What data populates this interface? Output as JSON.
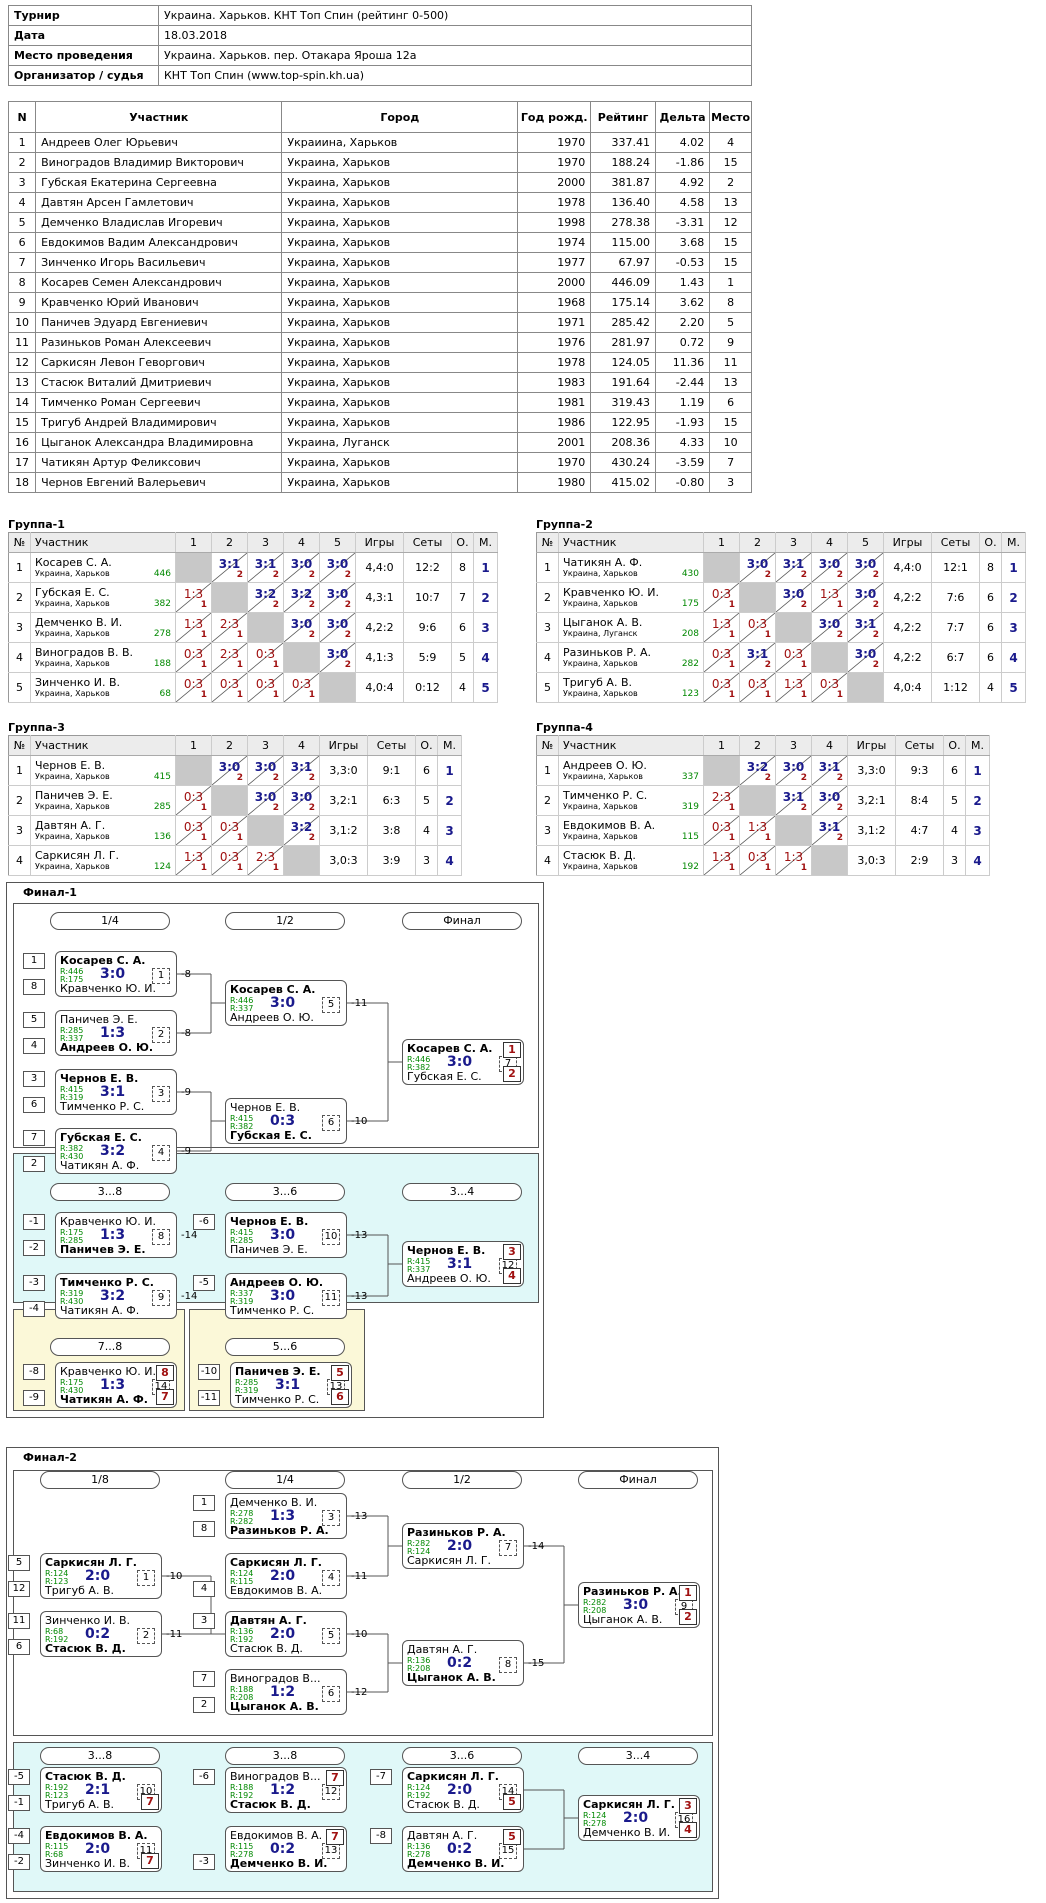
{
  "info": [
    {
      "k": "Турнир",
      "v": "Украина. Харьков. КНТ Топ Спин (рейтинг 0-500)"
    },
    {
      "k": "Дата",
      "v": "18.03.2018"
    },
    {
      "k": "Место проведения",
      "v": "Украина. Харьков. пер. Отакара Яроша 12а"
    },
    {
      "k": "Организатор / судья",
      "v": "КНТ Топ Спин (www.top-spin.kh.ua)"
    }
  ],
  "players_header": [
    "N",
    "Участник",
    "Город",
    "Год рожд.",
    "Рейтинг",
    "Дельта",
    "Место"
  ],
  "players": [
    [
      "1",
      "Андреев Олег Юрьевич",
      "Украиина, Харьков",
      "1970",
      "337.41",
      "4.02",
      "4"
    ],
    [
      "2",
      "Виноградов Владимир Викторович",
      "Украина, Харьков",
      "1970",
      "188.24",
      "-1.86",
      "15"
    ],
    [
      "3",
      "Губская Екатерина Сергеевна",
      "Украина, Харьков",
      "2000",
      "381.87",
      "4.92",
      "2"
    ],
    [
      "4",
      "Давтян Арсен Гамлетович",
      "Украина, Харьков",
      "1978",
      "136.40",
      "4.58",
      "13"
    ],
    [
      "5",
      "Демченко Владислав Игоревич",
      "Украина, Харьков",
      "1998",
      "278.38",
      "-3.31",
      "12"
    ],
    [
      "6",
      "Евдокимов Вадим Александрович",
      "Украина, Харьков",
      "1974",
      "115.00",
      "3.68",
      "15"
    ],
    [
      "7",
      "Зинченко Игорь Васильевич",
      "Украина, Харьков",
      "1977",
      "67.97",
      "-0.53",
      "15"
    ],
    [
      "8",
      "Косарев Семен Александрович",
      "Украина, Харьков",
      "2000",
      "446.09",
      "1.43",
      "1"
    ],
    [
      "9",
      "Кравченко Юрий Иванович",
      "Украина, Харьков",
      "1968",
      "175.14",
      "3.62",
      "8"
    ],
    [
      "10",
      "Паничев Эдуард Евгениевич",
      "Украина, Харьков",
      "1971",
      "285.42",
      "2.20",
      "5"
    ],
    [
      "11",
      "Разиньков Роман Алексеевич",
      "Украина, Харьков",
      "1976",
      "281.97",
      "0.72",
      "9"
    ],
    [
      "12",
      "Саркисян Левон Геворгович",
      "Украина, Харьков",
      "1978",
      "124.05",
      "11.36",
      "11"
    ],
    [
      "13",
      "Стасюк Виталий Дмитриевич",
      "Украина, Харьков",
      "1983",
      "191.64",
      "-2.44",
      "13"
    ],
    [
      "14",
      "Тимченко Роман Сергеевич",
      "Украина, Харьков",
      "1981",
      "319.43",
      "1.19",
      "6"
    ],
    [
      "15",
      "Тригуб Андрей Владимирович",
      "Украина, Харьков",
      "1986",
      "122.95",
      "-1.93",
      "15"
    ],
    [
      "16",
      "Цыганок Александра Владимировна",
      "Украина, Луганск",
      "2001",
      "208.36",
      "4.33",
      "10"
    ],
    [
      "17",
      "Чатикян Артур Феликсович",
      "Украина, Харьков",
      "1970",
      "430.24",
      "-3.59",
      "7"
    ],
    [
      "18",
      "Чернов Евгений Валерьевич",
      "Украина, Харьков",
      "1980",
      "415.02",
      "-0.80",
      "3"
    ]
  ],
  "groups": [
    {
      "title": "Группа-1",
      "rows": [
        {
          "n": "1",
          "name": "Косарев С. А.",
          "city": "Украина, Харьков",
          "r": "446",
          "cells": [
            "X",
            "3:1|2",
            "3:1|2",
            "3:0|2",
            "3:0|2"
          ],
          "games": "4,4:0",
          "sets": "12:2",
          "o": "8",
          "m": "1"
        },
        {
          "n": "2",
          "name": "Губская Е. С.",
          "city": "Украина, Харьков",
          "r": "382",
          "cells": [
            "1:3|1",
            "X",
            "3:2|2",
            "3:2|2",
            "3:0|2"
          ],
          "games": "4,3:1",
          "sets": "10:7",
          "o": "7",
          "m": "2"
        },
        {
          "n": "3",
          "name": "Демченко В. И.",
          "city": "Украина, Харьков",
          "r": "278",
          "cells": [
            "1:3|1",
            "2:3|1",
            "X",
            "3:0|2",
            "3:0|2"
          ],
          "games": "4,2:2",
          "sets": "9:6",
          "o": "6",
          "m": "3"
        },
        {
          "n": "4",
          "name": "Виноградов В. В.",
          "city": "Украина, Харьков",
          "r": "188",
          "cells": [
            "0:3|1",
            "2:3|1",
            "0:3|1",
            "X",
            "3:0|2"
          ],
          "games": "4,1:3",
          "sets": "5:9",
          "o": "5",
          "m": "4"
        },
        {
          "n": "5",
          "name": "Зинченко И. В.",
          "city": "Украина, Харьков",
          "r": "68",
          "cells": [
            "0:3|1",
            "0:3|1",
            "0:3|1",
            "0:3|1",
            "X"
          ],
          "games": "4,0:4",
          "sets": "0:12",
          "o": "4",
          "m": "5"
        }
      ]
    },
    {
      "title": "Группа-2",
      "rows": [
        {
          "n": "1",
          "name": "Чатикян А. Ф.",
          "city": "Украина, Харьков",
          "r": "430",
          "cells": [
            "X",
            "3:0|2",
            "3:1|2",
            "3:0|2",
            "3:0|2"
          ],
          "games": "4,4:0",
          "sets": "12:1",
          "o": "8",
          "m": "1"
        },
        {
          "n": "2",
          "name": "Кравченко Ю. И.",
          "city": "Украина, Харьков",
          "r": "175",
          "cells": [
            "0:3|1",
            "X",
            "3:0|2",
            "1:3|1",
            "3:0|2"
          ],
          "games": "4,2:2",
          "sets": "7:6",
          "o": "6",
          "m": "2"
        },
        {
          "n": "3",
          "name": "Цыганок А. В.",
          "city": "Украина, Луганск",
          "r": "208",
          "cells": [
            "1:3|1",
            "0:3|1",
            "X",
            "3:0|2",
            "3:1|2"
          ],
          "games": "4,2:2",
          "sets": "7:7",
          "o": "6",
          "m": "3"
        },
        {
          "n": "4",
          "name": "Разиньков Р. А.",
          "city": "Украина, Харьков",
          "r": "282",
          "cells": [
            "0:3|1",
            "3:1|2",
            "0:3|1",
            "X",
            "3:0|2"
          ],
          "games": "4,2:2",
          "sets": "6:7",
          "o": "6",
          "m": "4"
        },
        {
          "n": "5",
          "name": "Тригуб А. В.",
          "city": "Украина, Харьков",
          "r": "123",
          "cells": [
            "0:3|1",
            "0:3|1",
            "1:3|1",
            "0:3|1",
            "X"
          ],
          "games": "4,0:4",
          "sets": "1:12",
          "o": "4",
          "m": "5"
        }
      ]
    },
    {
      "title": "Группа-3",
      "rows": [
        {
          "n": "1",
          "name": "Чернов Е. В.",
          "city": "Украина, Харьков",
          "r": "415",
          "cells": [
            "X",
            "3:0|2",
            "3:0|2",
            "3:1|2"
          ],
          "games": "3,3:0",
          "sets": "9:1",
          "o": "6",
          "m": "1"
        },
        {
          "n": "2",
          "name": "Паничев Э. Е.",
          "city": "Украина, Харьков",
          "r": "285",
          "cells": [
            "0:3|1",
            "X",
            "3:0|2",
            "3:0|2"
          ],
          "games": "3,2:1",
          "sets": "6:3",
          "o": "5",
          "m": "2"
        },
        {
          "n": "3",
          "name": "Давтян А. Г.",
          "city": "Украина, Харьков",
          "r": "136",
          "cells": [
            "0:3|1",
            "0:3|1",
            "X",
            "3:2|2"
          ],
          "games": "3,1:2",
          "sets": "3:8",
          "o": "4",
          "m": "3"
        },
        {
          "n": "4",
          "name": "Саркисян Л. Г.",
          "city": "Украина, Харьков",
          "r": "124",
          "cells": [
            "1:3|1",
            "0:3|1",
            "2:3|1",
            "X"
          ],
          "games": "3,0:3",
          "sets": "3:9",
          "o": "3",
          "m": "4"
        }
      ]
    },
    {
      "title": "Группа-4",
      "rows": [
        {
          "n": "1",
          "name": "Андреев О. Ю.",
          "city": "Украиина, Харьков",
          "r": "337",
          "cells": [
            "X",
            "3:2|2",
            "3:0|2",
            "3:1|2"
          ],
          "games": "3,3:0",
          "sets": "9:3",
          "o": "6",
          "m": "1"
        },
        {
          "n": "2",
          "name": "Тимченко Р. С.",
          "city": "Украина, Харьков",
          "r": "319",
          "cells": [
            "2:3|1",
            "X",
            "3:1|2",
            "3:0|2"
          ],
          "games": "3,2:1",
          "sets": "8:4",
          "o": "5",
          "m": "2"
        },
        {
          "n": "3",
          "name": "Евдокимов В. А.",
          "city": "Украина, Харьков",
          "r": "115",
          "cells": [
            "0:3|1",
            "1:3|1",
            "X",
            "3:1|2"
          ],
          "games": "3,1:2",
          "sets": "4:7",
          "o": "4",
          "m": "3"
        },
        {
          "n": "4",
          "name": "Стасюк В. Д.",
          "city": "Украина, Харьков",
          "r": "192",
          "cells": [
            "1:3|1",
            "0:3|1",
            "1:3|1",
            "X"
          ],
          "games": "3,0:3",
          "sets": "2:9",
          "o": "3",
          "m": "4"
        }
      ]
    }
  ],
  "group_header": [
    "№",
    "Участник",
    "Игры",
    "Сеты",
    "О.",
    "М."
  ],
  "final1": {
    "title": "Финал-1",
    "rounds": [
      "1/4",
      "1/2",
      "Финал"
    ],
    "rounds_b": [
      "3...8",
      "3...6",
      "3...4"
    ],
    "rounds_c": [
      "7...8",
      "5...6"
    ]
  },
  "final2": {
    "title": "Финал-2",
    "rounds": [
      "1/8",
      "1/4",
      "1/2",
      "Финал"
    ],
    "rounds_b": [
      "3...8",
      "3...8",
      "3...6",
      "3...4"
    ]
  },
  "matches": [
    {
      "id": "f1q1",
      "p1": "Косарев С. А.",
      "p2": "Кравченко Ю. И.",
      "w": 1,
      "r1": "R:446",
      "r2": "R:175",
      "score": "3:0",
      "no": "1"
    },
    {
      "id": "f1q2",
      "p1": "Паничев Э. Е.",
      "p2": "Андреев О. Ю.",
      "w": 2,
      "r1": "R:285",
      "r2": "R:337",
      "score": "1:3",
      "no": "2"
    },
    {
      "id": "f1q3",
      "p1": "Чернов Е. В.",
      "p2": "Тимченко Р. С.",
      "w": 1,
      "r1": "R:415",
      "r2": "R:319",
      "score": "3:1",
      "no": "3"
    },
    {
      "id": "f1q4",
      "p1": "Губская Е. С.",
      "p2": "Чатикян А. Ф.",
      "w": 1,
      "r1": "R:382",
      "r2": "R:430",
      "score": "3:2",
      "no": "4"
    },
    {
      "id": "f1s1",
      "p1": "Косарев С. А.",
      "p2": "Андреев О. Ю.",
      "w": 1,
      "r1": "R:446",
      "r2": "R:337",
      "score": "3:0",
      "no": "5"
    },
    {
      "id": "f1s2",
      "p1": "Чернов Е. В.",
      "p2": "Губская Е. С.",
      "w": 2,
      "r1": "R:415",
      "r2": "R:382",
      "score": "0:3",
      "no": "6"
    },
    {
      "id": "f1f",
      "p1": "Косарев С. А.",
      "p2": "Губская Е. С.",
      "w": 1,
      "r1": "R:446",
      "r2": "R:382",
      "score": "3:0",
      "no": "7",
      "pk1": "1",
      "pk2": "2"
    },
    {
      "id": "f1b1",
      "p1": "Кравченко Ю. И.",
      "p2": "Паничев Э. Е.",
      "w": 2,
      "r1": "R:175",
      "r2": "R:285",
      "score": "1:3",
      "no": "8"
    },
    {
      "id": "f1b2",
      "p1": "Тимченко Р. С.",
      "p2": "Чатикян А. Ф.",
      "w": 1,
      "r1": "R:319",
      "r2": "R:430",
      "score": "3:2",
      "no": "9"
    },
    {
      "id": "f1b3",
      "p1": "Чернов Е. В.",
      "p2": "Паничев Э. Е.",
      "w": 1,
      "r1": "R:415",
      "r2": "R:285",
      "score": "3:0",
      "no": "10"
    },
    {
      "id": "f1b4",
      "p1": "Андреев О. Ю.",
      "p2": "Тимченко Р. С.",
      "w": 1,
      "r1": "R:337",
      "r2": "R:319",
      "score": "3:0",
      "no": "11"
    },
    {
      "id": "f1b5",
      "p1": "Чернов Е. В.",
      "p2": "Андреев О. Ю.",
      "w": 1,
      "r1": "R:415",
      "r2": "R:337",
      "score": "3:1",
      "no": "12",
      "pk1": "3",
      "pk2": "4"
    },
    {
      "id": "f1c1",
      "p1": "Кравченко Ю. И.",
      "p2": "Чатикян А. Ф.",
      "w": 2,
      "r1": "R:175",
      "r2": "R:430",
      "score": "1:3",
      "no": "14",
      "pk1": "8",
      "pk2": "7"
    },
    {
      "id": "f1c2",
      "p1": "Паничев Э. Е.",
      "p2": "Тимченко Р. С.",
      "w": 1,
      "r1": "R:285",
      "r2": "R:319",
      "score": "3:1",
      "no": "13",
      "pk1": "5",
      "pk2": "6"
    },
    {
      "id": "f2a1",
      "p1": "Демченко В. И.",
      "p2": "Разиньков Р. А.",
      "w": 2,
      "r1": "R:278",
      "r2": "R:282",
      "score": "1:3",
      "no": "3"
    },
    {
      "id": "f2e1",
      "p1": "Саркисян Л. Г.",
      "p2": "Тригуб А. В.",
      "w": 1,
      "r1": "R:124",
      "r2": "R:123",
      "score": "2:0",
      "no": "1"
    },
    {
      "id": "f2e2",
      "p1": "Зинченко И. В.",
      "p2": "Стасюк В. Д.",
      "w": 2,
      "r1": "R:68",
      "r2": "R:192",
      "score": "0:2",
      "no": "2"
    },
    {
      "id": "f2q2",
      "p1": "Саркисян Л. Г.",
      "p2": "Евдокимов В. А.",
      "w": 1,
      "r1": "R:124",
      "r2": "R:115",
      "score": "2:0",
      "no": "4"
    },
    {
      "id": "f2q3",
      "p1": "Давтян А. Г.",
      "p2": "Стасюк В. Д.",
      "w": 1,
      "r1": "R:136",
      "r2": "R:192",
      "score": "2:0",
      "no": "5"
    },
    {
      "id": "f2q4",
      "p1": "Виноградов В...",
      "p2": "Цыганок А. В.",
      "w": 2,
      "r1": "R:188",
      "r2": "R:208",
      "score": "1:2",
      "no": "6"
    },
    {
      "id": "f2s1",
      "p1": "Разиньков Р. А.",
      "p2": "Саркисян Л. Г.",
      "w": 1,
      "r1": "R:282",
      "r2": "R:124",
      "score": "2:0",
      "no": "7"
    },
    {
      "id": "f2s2",
      "p1": "Давтян А. Г.",
      "p2": "Цыганок А. В.",
      "w": 2,
      "r1": "R:136",
      "r2": "R:208",
      "score": "0:2",
      "no": "8"
    },
    {
      "id": "f2f",
      "p1": "Разиньков Р. А.",
      "p2": "Цыганок А. В.",
      "w": 1,
      "r1": "R:282",
      "r2": "R:208",
      "score": "3:0",
      "no": "9",
      "pk1": "1",
      "pk2": "2"
    },
    {
      "id": "f2b1",
      "p1": "Стасюк В. Д.",
      "p2": "Тригуб А. В.",
      "w": 1,
      "r1": "R:192",
      "r2": "R:123",
      "score": "2:1",
      "no": "10",
      "pk2": "7"
    },
    {
      "id": "f2b2",
      "p1": "Евдокимов В. А.",
      "p2": "Зинченко И. В.",
      "w": 1,
      "r1": "R:115",
      "r2": "R:68",
      "score": "2:0",
      "no": "11",
      "pk2": "7"
    },
    {
      "id": "f2b3",
      "p1": "Виноградов В...",
      "p2": "Стасюк В. Д.",
      "w": 2,
      "r1": "R:188",
      "r2": "R:192",
      "score": "1:2",
      "no": "12",
      "pk1": "7"
    },
    {
      "id": "f2b4",
      "p1": "Евдокимов В. А.",
      "p2": "Демченко В. И.",
      "w": 2,
      "r1": "R:115",
      "r2": "R:278",
      "score": "0:2",
      "no": "13",
      "pk1": "7"
    },
    {
      "id": "f2b5",
      "p1": "Саркисян Л. Г.",
      "p2": "Стасюк В. Д.",
      "w": 1,
      "r1": "R:124",
      "r2": "R:192",
      "score": "2:0",
      "no": "14",
      "pk2": "5"
    },
    {
      "id": "f2b6",
      "p1": "Давтян А. Г.",
      "p2": "Демченко В. И.",
      "w": 2,
      "r1": "R:136",
      "r2": "R:278",
      "score": "0:2",
      "no": "15",
      "pk1": "5"
    },
    {
      "id": "f2b7",
      "p1": "Саркисян Л. Г.",
      "p2": "Демченко В. И.",
      "w": 1,
      "r1": "R:124",
      "r2": "R:278",
      "score": "2:0",
      "no": "16",
      "pk1": "3",
      "pk2": "4"
    }
  ],
  "seeds": {
    "f1q1": [
      "1",
      "8"
    ],
    "f1q2": [
      "5",
      "4"
    ],
    "f1q3": [
      "3",
      "6"
    ],
    "f1q4": [
      "7",
      "2"
    ],
    "f1b1": [
      "-1",
      "-2"
    ],
    "f1b2": [
      "-3",
      "-4"
    ],
    "f1b3": [
      "-6",
      ""
    ],
    "f1b4": [
      "-5",
      ""
    ],
    "f1c1": [
      "-8",
      "-9"
    ],
    "f1c2": [
      "-10",
      "-11"
    ],
    "f2a1": [
      "1",
      "8"
    ],
    "f2e1": [
      "5",
      "12"
    ],
    "f2e2": [
      "11",
      "6"
    ],
    "f2q2": [
      "",
      "4"
    ],
    "f2q3": [
      "3",
      ""
    ],
    "f2q4": [
      "7",
      "2"
    ],
    "f2b1": [
      "-5",
      "-1"
    ],
    "f2b2": [
      "-4",
      "-2"
    ],
    "f2b3": [
      "-6",
      ""
    ],
    "f2b4": [
      "",
      "-3"
    ],
    "f2b5": [
      "-7",
      ""
    ],
    "f2b6": [
      "-8",
      ""
    ]
  },
  "losers": {
    "f1q1": "-8",
    "f1q2": "-8",
    "f1q3": "-9",
    "f1q4": "-9",
    "f1s1": "-11",
    "f1s2": "-10",
    "f1b1": "-14",
    "f1b2": "-14",
    "f1b3": "-13",
    "f1b4": "-13",
    "f2a1": "-13",
    "f2e1": "-10",
    "f2e2": "-11",
    "f2q2": "-11",
    "f2q3": "-10",
    "f2q4": "-12",
    "f2s1": "-14",
    "f2s2": "-15"
  }
}
